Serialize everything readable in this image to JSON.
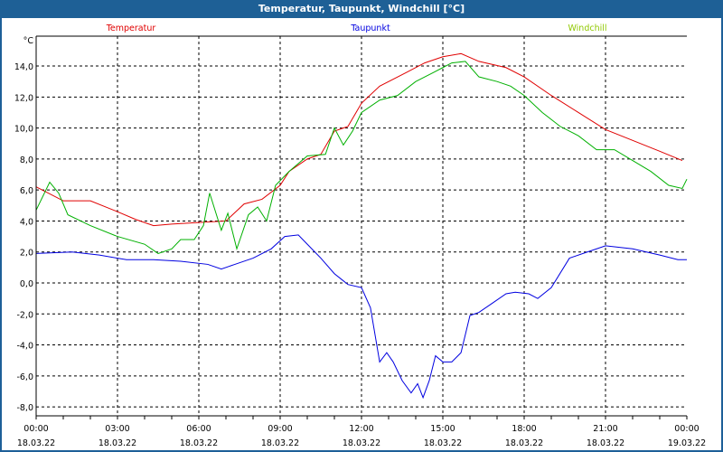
{
  "window": {
    "title": "Temperatur, Taupunkt, Windchill [°C]"
  },
  "chart_data": {
    "type": "line",
    "title": "Temperatur, Taupunkt, Windchill [°C]",
    "ylabel": "°C",
    "ylim": [
      -8.6,
      15.9
    ],
    "yticks": [
      14,
      12,
      10,
      8,
      6,
      4,
      2,
      0,
      -2,
      -4,
      -6,
      -8
    ],
    "ytick_labels": [
      "14,0",
      "12,0",
      "10,0",
      "8,0",
      "6,0",
      "4,0",
      "2,0",
      "0,0",
      "-2,0",
      "-4,0",
      "-6,0",
      "-8,0"
    ],
    "xlim": [
      0,
      24
    ],
    "xticks": [
      0,
      3,
      6,
      9,
      12,
      15,
      18,
      21,
      24
    ],
    "xtick_labels": [
      [
        "00:00",
        "18.03.22"
      ],
      [
        "03:00",
        "18.03.22"
      ],
      [
        "06:00",
        "18.03.22"
      ],
      [
        "09:00",
        "18.03.22"
      ],
      [
        "12:00",
        "18.03.22"
      ],
      [
        "15:00",
        "18.03.22"
      ],
      [
        "18:00",
        "18.03.22"
      ],
      [
        "21:00",
        "18.03.22"
      ],
      [
        "00:00",
        "19.03.22"
      ]
    ],
    "grid": true,
    "legend_placement": "top",
    "series": [
      {
        "name": "Temperatur",
        "color": "#e00000",
        "points": [
          [
            0,
            6.2
          ],
          [
            1,
            5.3
          ],
          [
            2,
            5.3
          ],
          [
            3,
            4.6
          ],
          [
            3.67,
            4.1
          ],
          [
            4.33,
            3.7
          ],
          [
            5,
            3.8
          ],
          [
            6,
            3.9
          ],
          [
            7,
            4.0
          ],
          [
            7.67,
            5.1
          ],
          [
            8.33,
            5.4
          ],
          [
            9,
            6.3
          ],
          [
            9.33,
            7.2
          ],
          [
            10,
            8.0
          ],
          [
            10.5,
            8.3
          ],
          [
            11,
            9.8
          ],
          [
            11.5,
            10.1
          ],
          [
            12,
            11.6
          ],
          [
            12.67,
            12.7
          ],
          [
            13.67,
            13.6
          ],
          [
            14.33,
            14.2
          ],
          [
            15,
            14.6
          ],
          [
            15.67,
            14.8
          ],
          [
            16.33,
            14.3
          ],
          [
            17.33,
            13.9
          ],
          [
            18,
            13.3
          ],
          [
            19,
            12.1
          ],
          [
            20,
            11.0
          ],
          [
            21,
            9.9
          ],
          [
            22,
            9.2
          ],
          [
            23,
            8.5
          ],
          [
            23.83,
            7.9
          ]
        ]
      },
      {
        "name": "Taupunkt",
        "color": "#0000e0",
        "points": [
          [
            0,
            1.9
          ],
          [
            1.33,
            2.0
          ],
          [
            2.33,
            1.8
          ],
          [
            3.33,
            1.5
          ],
          [
            4.33,
            1.5
          ],
          [
            5.33,
            1.4
          ],
          [
            6.33,
            1.2
          ],
          [
            6.83,
            0.9
          ],
          [
            7.33,
            1.2
          ],
          [
            8,
            1.6
          ],
          [
            8.67,
            2.2
          ],
          [
            9.17,
            3.0
          ],
          [
            9.67,
            3.1
          ],
          [
            10,
            2.5
          ],
          [
            10.5,
            1.6
          ],
          [
            11,
            0.6
          ],
          [
            11.5,
            -0.1
          ],
          [
            12,
            -0.3
          ],
          [
            12.33,
            -1.6
          ],
          [
            12.67,
            -5.1
          ],
          [
            12.93,
            -4.5
          ],
          [
            13.17,
            -5.1
          ],
          [
            13.5,
            -6.3
          ],
          [
            13.83,
            -7.1
          ],
          [
            14.07,
            -6.5
          ],
          [
            14.27,
            -7.4
          ],
          [
            14.5,
            -6.3
          ],
          [
            14.73,
            -4.7
          ],
          [
            15,
            -5.1
          ],
          [
            15.33,
            -5.1
          ],
          [
            15.67,
            -4.5
          ],
          [
            16,
            -2.1
          ],
          [
            16.33,
            -1.9
          ],
          [
            16.83,
            -1.3
          ],
          [
            17.33,
            -0.7
          ],
          [
            17.67,
            -0.6
          ],
          [
            18.17,
            -0.7
          ],
          [
            18.5,
            -1.0
          ],
          [
            19,
            -0.3
          ],
          [
            19.67,
            1.6
          ],
          [
            20.33,
            2.0
          ],
          [
            21,
            2.4
          ],
          [
            22,
            2.2
          ],
          [
            23,
            1.8
          ],
          [
            23.67,
            1.5
          ],
          [
            24,
            1.5
          ]
        ]
      },
      {
        "name": "Windchill",
        "color": "#00b000",
        "legend_color": "#90c800",
        "points": [
          [
            0,
            4.7
          ],
          [
            0.5,
            6.5
          ],
          [
            0.83,
            5.8
          ],
          [
            1.17,
            4.4
          ],
          [
            2,
            3.7
          ],
          [
            3,
            3.0
          ],
          [
            4,
            2.5
          ],
          [
            4.5,
            1.9
          ],
          [
            5,
            2.2
          ],
          [
            5.33,
            2.8
          ],
          [
            5.83,
            2.8
          ],
          [
            6.17,
            3.7
          ],
          [
            6.4,
            5.8
          ],
          [
            6.83,
            3.4
          ],
          [
            7.07,
            4.5
          ],
          [
            7.4,
            2.2
          ],
          [
            7.83,
            4.4
          ],
          [
            8.17,
            4.9
          ],
          [
            8.5,
            4.0
          ],
          [
            8.83,
            6.3
          ],
          [
            9.33,
            7.2
          ],
          [
            10,
            8.2
          ],
          [
            10.67,
            8.3
          ],
          [
            11,
            10.0
          ],
          [
            11.33,
            8.9
          ],
          [
            11.67,
            9.8
          ],
          [
            12,
            11.0
          ],
          [
            12.67,
            11.8
          ],
          [
            13.33,
            12.1
          ],
          [
            14,
            13.0
          ],
          [
            14.67,
            13.6
          ],
          [
            15,
            13.9
          ],
          [
            15.33,
            14.2
          ],
          [
            15.83,
            14.3
          ],
          [
            16.33,
            13.3
          ],
          [
            17,
            13.0
          ],
          [
            17.5,
            12.7
          ],
          [
            18,
            12.1
          ],
          [
            18.67,
            11.0
          ],
          [
            19.33,
            10.1
          ],
          [
            20,
            9.5
          ],
          [
            20.67,
            8.6
          ],
          [
            21.33,
            8.6
          ],
          [
            22,
            7.9
          ],
          [
            22.67,
            7.2
          ],
          [
            23.33,
            6.3
          ],
          [
            23.83,
            6.1
          ],
          [
            24,
            6.7
          ]
        ]
      }
    ]
  }
}
